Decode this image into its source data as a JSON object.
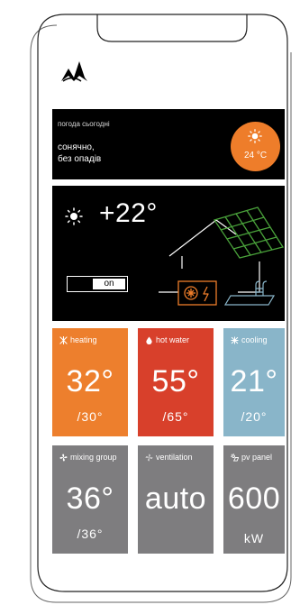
{
  "weather": {
    "caption": "погода сьогодні",
    "desc_line1": "сонячно,",
    "desc_line2": "без опадів",
    "temp": "24 °C",
    "icon": "sun-icon",
    "accent": "#ee7d2a"
  },
  "house": {
    "temp": "+22°",
    "icon": "sun-icon",
    "toggle_label": "on"
  },
  "tiles": [
    {
      "label": "heating",
      "icon": "heating-icon",
      "value": "32°",
      "setpoint": "/30°",
      "color": "#ed7f2d"
    },
    {
      "label": "hot water",
      "icon": "water-drop-icon",
      "value": "55°",
      "setpoint": "/65°",
      "color": "#d8402b"
    },
    {
      "label": "cooling",
      "icon": "snowflake-icon",
      "value": "21°",
      "setpoint": "/20°",
      "color": "#89b5c9"
    },
    {
      "label": "mixing group",
      "icon": "fan-icon",
      "value": "36°",
      "setpoint": "/36°",
      "color": "#7e7d7f"
    },
    {
      "label": "ventilation",
      "icon": "ventilation-icon",
      "value": "auto",
      "color": "#7e7d7f"
    },
    {
      "label": "pv panel",
      "icon": "sun-panel-icon",
      "value": "600",
      "unit": "kW",
      "color": "#7e7d7f"
    }
  ]
}
